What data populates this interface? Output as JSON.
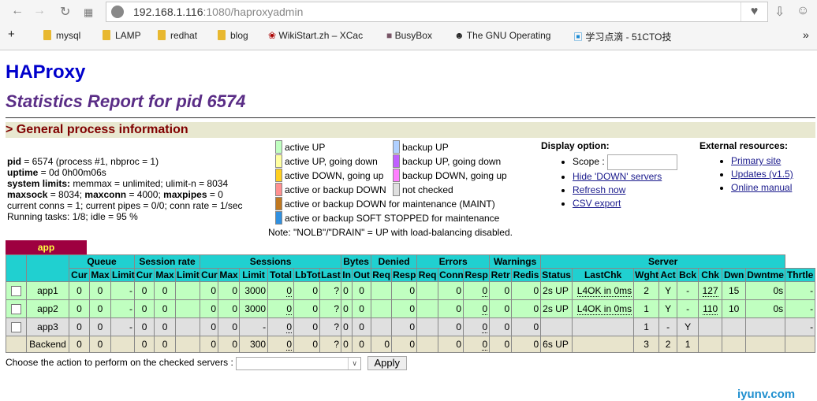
{
  "browser": {
    "url_host": "192.168.1.116",
    "url_path": ":1080/haproxyadmin",
    "bookmarks": [
      "mysql",
      "LAMP",
      "redhat",
      "blog",
      "WikiStart.zh – XCac",
      "BusyBox",
      "The GNU Operating",
      "学习点滴 - 51CTO技"
    ]
  },
  "title": "HAProxy",
  "subtitle": "Statistics Report for pid 6574",
  "section": "> General process information",
  "info": [
    {
      "b": "pid",
      "t": " = 6574 (process #1, nbproc = 1)"
    },
    {
      "b": "uptime",
      "t": " = 0d 0h00m06s"
    },
    {
      "b": "system limits:",
      "t": " memmax = unlimited; ulimit-n = 8034"
    },
    {
      "b": "maxsock",
      "t": " = 8034; ",
      "b2": "maxconn",
      "t2": " = 4000; ",
      "b3": "maxpipes",
      "t3": " = 0"
    },
    {
      "t": "current conns = 1; current pipes = 0/0; conn rate = 1/sec"
    },
    {
      "t": "Running tasks: 1/8; idle = 95 %"
    }
  ],
  "legend": [
    {
      "label": "active UP",
      "color": "#c0ffc0"
    },
    {
      "label": "backup UP",
      "color": "#b0d0ff"
    },
    {
      "label": "active UP, going down",
      "color": "#ffffa0"
    },
    {
      "label": "backup UP, going down",
      "color": "#c060ff"
    },
    {
      "label": "active DOWN, going up",
      "color": "#ffd020"
    },
    {
      "label": "backup DOWN, going up",
      "color": "#ff80ff"
    },
    {
      "label": "active or backup DOWN",
      "color": "#ff9090"
    },
    {
      "label": "not checked",
      "color": "#e0e0e0"
    },
    {
      "label": "active or backup DOWN for maintenance (MAINT)",
      "color": "#c07820"
    },
    {
      "label": "active or backup SOFT STOPPED for maintenance",
      "color": "#3090e0"
    }
  ],
  "note": "Note: \"NOLB\"/\"DRAIN\" = UP with load-balancing disabled.",
  "display": {
    "title": "Display option:",
    "scope": "Scope :",
    "links": [
      "Hide 'DOWN' servers",
      "Refresh now",
      "CSV export"
    ]
  },
  "external": {
    "title": "External resources:",
    "links": [
      "Primary site",
      "Updates (v1.5)",
      "Online manual"
    ]
  },
  "proxy": {
    "name": "app",
    "groups": [
      [
        "",
        1
      ],
      [
        "",
        1
      ],
      [
        "Queue",
        3
      ],
      [
        "Session rate",
        3
      ],
      [
        "Sessions",
        6
      ],
      [
        "Bytes",
        2
      ],
      [
        "Denied",
        2
      ],
      [
        "Errors",
        3
      ],
      [
        "Warnings",
        2
      ],
      [
        "Server",
        8
      ]
    ],
    "columns": [
      "",
      "",
      "Cur",
      "Max",
      "Limit",
      "Cur",
      "Max",
      "Limit",
      "Cur",
      "Max",
      "Limit",
      "Total",
      "LbTot",
      "Last",
      "In",
      "Out",
      "Req",
      "Resp",
      "Req",
      "Conn",
      "Resp",
      "Retr",
      "Redis",
      "Status",
      "LastChk",
      "Wght",
      "Act",
      "Bck",
      "Chk",
      "Dwn",
      "Dwntme",
      "Thrtle"
    ],
    "rows": [
      {
        "cls": "up",
        "cb": true,
        "cells": [
          "app1",
          "0",
          "0",
          "-",
          "0",
          "0",
          "",
          "0",
          "0",
          "3000",
          "0",
          "0",
          "?",
          "0",
          "0",
          "",
          "0",
          "",
          "0",
          "0",
          "0",
          "0",
          "2s UP",
          "L4OK in 0ms",
          "2",
          "Y",
          "-",
          "127",
          "15",
          "0s",
          "-"
        ]
      },
      {
        "cls": "up",
        "cb": true,
        "cells": [
          "app2",
          "0",
          "0",
          "-",
          "0",
          "0",
          "",
          "0",
          "0",
          "3000",
          "0",
          "0",
          "?",
          "0",
          "0",
          "",
          "0",
          "",
          "0",
          "0",
          "0",
          "0",
          "2s UP",
          "L4OK in 0ms",
          "1",
          "Y",
          "-",
          "110",
          "10",
          "0s",
          "-"
        ]
      },
      {
        "cls": "nc",
        "cb": true,
        "cells": [
          "app3",
          "0",
          "0",
          "-",
          "0",
          "0",
          "",
          "0",
          "0",
          "-",
          "0",
          "0",
          "?",
          "0",
          "0",
          "",
          "0",
          "",
          "0",
          "0",
          "0",
          "0",
          "",
          "",
          "1",
          "-",
          "Y",
          "",
          "",
          "",
          "-"
        ]
      },
      {
        "cls": "be",
        "cb": false,
        "cells": [
          "Backend",
          "0",
          "0",
          "",
          "0",
          "0",
          "",
          "0",
          "0",
          "300",
          "0",
          "0",
          "?",
          "0",
          "0",
          "0",
          "0",
          "",
          "0",
          "0",
          "0",
          "0",
          "6s UP",
          "",
          "3",
          "2",
          "1",
          "",
          "",
          "",
          ""
        ]
      }
    ]
  },
  "action": {
    "label": "Choose the action to perform on the checked servers :",
    "apply": "Apply"
  },
  "watermark": "iyunv.com"
}
